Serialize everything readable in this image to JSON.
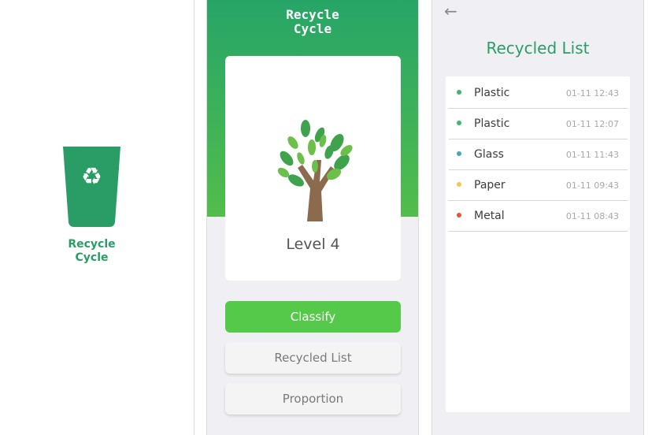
{
  "splash": {
    "title_line1": "Recycle",
    "title_line2": "Cycle",
    "icon": "recycle-bin-icon",
    "recycle_symbol": "♻"
  },
  "home": {
    "title_line1": "Recycle",
    "title_line2": "Cycle",
    "level_label": "Level 4",
    "tree_icon": "tree-icon",
    "buttons": {
      "classify": "Classify",
      "recycled_list": "Recycled List",
      "proportion": "Proportion"
    }
  },
  "recycled_list": {
    "back_icon": "back-arrow-icon",
    "back_glyph": "←",
    "title": "Recycled List",
    "items": [
      {
        "name": "Plastic",
        "time": "01-11 12:43",
        "color": "#3fb56e"
      },
      {
        "name": "Plastic",
        "time": "01-11 12:07",
        "color": "#3fb56e"
      },
      {
        "name": "Glass",
        "time": "01-11 11:43",
        "color": "#4aa6b5"
      },
      {
        "name": "Paper",
        "time": "01-11 09:43",
        "color": "#f2c84b"
      },
      {
        "name": "Metal",
        "time": "01-11 08:43",
        "color": "#e5533d"
      }
    ]
  },
  "colors": {
    "brand_green": "#2a9d66",
    "header_gradient_top": "#27a568",
    "header_gradient_bottom": "#52bd4b",
    "primary_button": "#55c94a"
  }
}
